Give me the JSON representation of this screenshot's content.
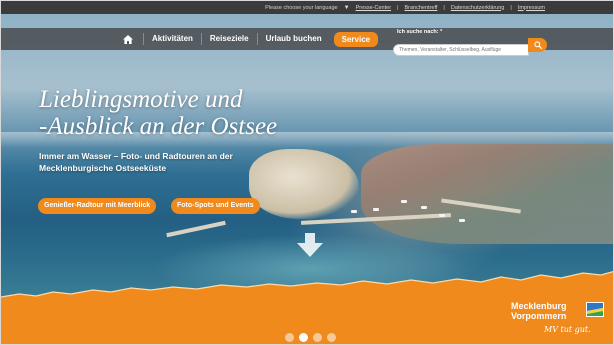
{
  "topbar": {
    "language_prompt": "Please choose your language",
    "links": [
      "Presse-Center",
      "Branchentreff",
      "Datenschutzerklärung",
      "Impressum"
    ]
  },
  "nav": {
    "items": [
      {
        "label": "Aktivitäten"
      },
      {
        "label": "Reiseziele"
      },
      {
        "label": "Urlaub buchen"
      },
      {
        "label": "Service"
      }
    ],
    "active_item": "Service"
  },
  "search": {
    "label": "Ich suche nach: *",
    "placeholder": "Themen, Veranstalter, Schlüsselbeg. Ausflüge"
  },
  "hero": {
    "headline_line1": "Lieblingsmotive und",
    "headline_line2": "-Ausblick an der Ostsee",
    "subline_line1": "Immer am Wasser – Foto- und Radtouren an der",
    "subline_line2": "Mecklenburgische Ostseeküste",
    "buttons": [
      "Genießer-Radtour mit Meerblick",
      "Foto-Spots und Events"
    ]
  },
  "logo": {
    "line1": "Mecklenburg",
    "line2": "Vorpommern",
    "slogan": "MV tut gut."
  },
  "pager": {
    "count": 4,
    "active_index": 1
  },
  "colors": {
    "accent": "#f08a1c",
    "nav_bg": "#46484a",
    "topbar_bg": "#3b3b3b"
  },
  "icons": {
    "home": "home-icon",
    "search": "search-icon",
    "language_caret": "caret-down-icon",
    "scroll": "arrow-down-icon"
  }
}
